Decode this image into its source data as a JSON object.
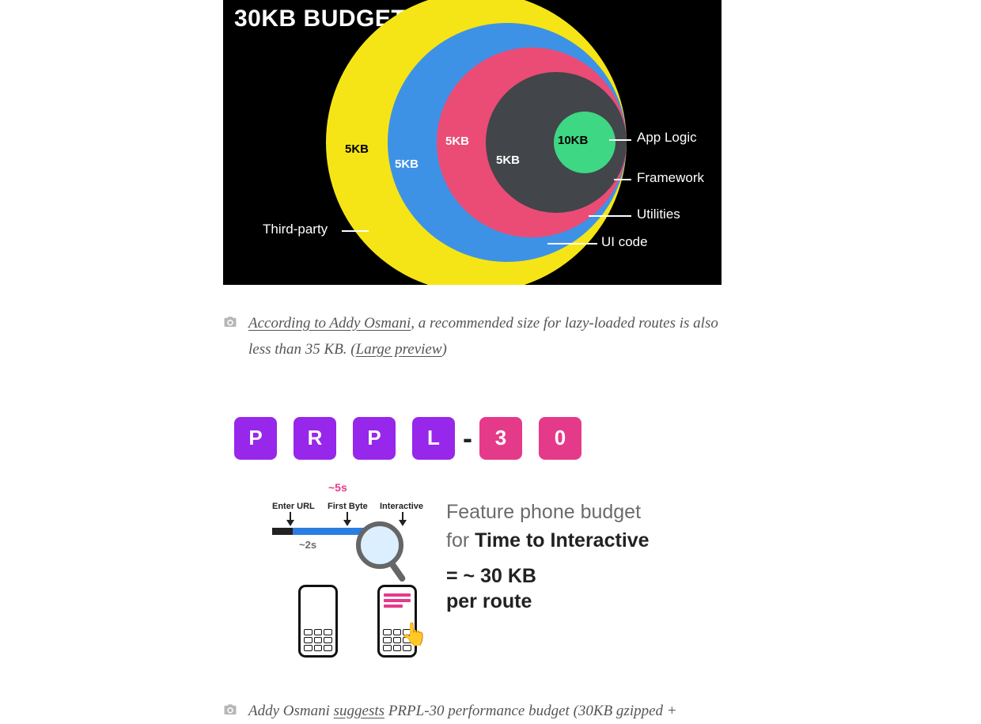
{
  "figure1": {
    "title": "30KB BUDGET",
    "rings": {
      "yellow": "5KB",
      "blue": "5KB",
      "pink": "5KB",
      "gray": "5KB",
      "green": "10KB"
    },
    "callouts": {
      "app_logic": "App Logic",
      "framework": "Framework",
      "utilities": "Utilities",
      "ui_code": "UI code",
      "third_party": "Third-party"
    }
  },
  "caption1": {
    "link1_text": "According to Addy Osmani",
    "mid_text": ", a recommended size for lazy-loaded routes is also less than 35 KB. (",
    "link2_text": "Large preview",
    "tail_text": ")"
  },
  "figure2": {
    "letters": {
      "p1": "P",
      "r": "R",
      "p2": "P",
      "l": "L",
      "three": "3",
      "zero": "0"
    },
    "hyphen": "-",
    "headline": {
      "line1": "Feature phone budget",
      "line2a": "for ",
      "line2b": "Time to Interactive"
    },
    "sub": {
      "line1": "= ~ 30 KB",
      "line2": "per route"
    },
    "timeline": {
      "five_s": "~5s",
      "enter_url": "Enter URL",
      "first_byte": "First Byte",
      "interactive": "Interactive",
      "two_s": "~2s"
    }
  },
  "caption2": {
    "pre_text": "Addy Osmani ",
    "link_text": "suggests",
    "post_text": " PRPL-30 performance budget (30KB gzipped +"
  },
  "chart_data": {
    "type": "pie",
    "title": "30KB Budget",
    "series": [
      {
        "name": "App Logic",
        "value_kb": 10
      },
      {
        "name": "Framework",
        "value_kb": 5
      },
      {
        "name": "Utilities",
        "value_kb": 5
      },
      {
        "name": "UI code",
        "value_kb": 5
      },
      {
        "name": "Third-party",
        "value_kb": 5
      }
    ],
    "total_kb": 30
  }
}
